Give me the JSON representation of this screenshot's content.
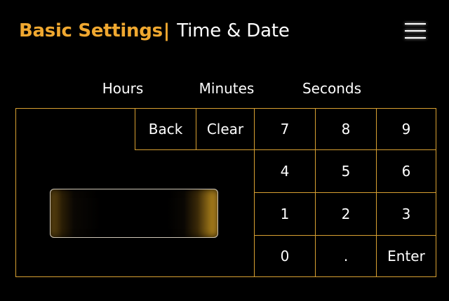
{
  "header": {
    "title": "Basic Settings",
    "separator": "|",
    "subtitle": "Time & Date"
  },
  "menu_icon": "hamburger-menu-icon",
  "columns": {
    "hours": "Hours",
    "minutes": "Minutes",
    "seconds": "Seconds"
  },
  "display": {
    "value": ""
  },
  "keypad": {
    "back": "Back",
    "clear": "Clear",
    "k7": "7",
    "k8": "8",
    "k9": "9",
    "k4": "4",
    "k5": "5",
    "k6": "6",
    "k1": "1",
    "k2": "2",
    "k3": "3",
    "k0": "0",
    "dot": ".",
    "enter": "Enter"
  },
  "colors": {
    "accent": "#f0a830",
    "border": "#d8a032",
    "background": "#000000",
    "text": "#ffffff"
  }
}
